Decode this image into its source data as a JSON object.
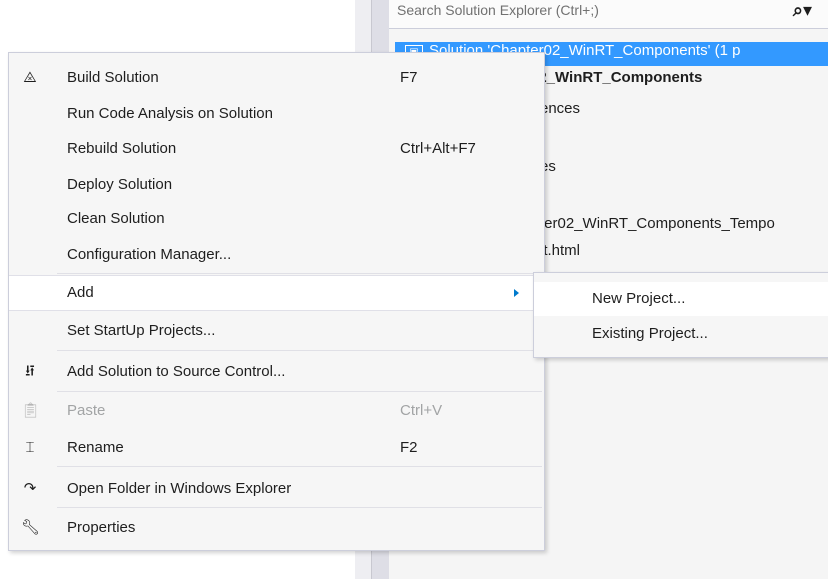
{
  "solution_explorer": {
    "search_placeholder": "Search Solution Explorer (Ctrl+;)",
    "search_icon": "magnifier-dropdown-icon",
    "selected_row": "Solution 'Chapter02_WinRT_Components' (1 p",
    "rows": [
      "02_WinRT_Components",
      "ences",
      "es",
      "ter02_WinRT_Components_Tempo",
      "lt.html"
    ]
  },
  "menu": {
    "items": [
      {
        "label": "Build Solution",
        "shortcut": "F7",
        "icon": "build-icon"
      },
      {
        "label": "Run Code Analysis on Solution",
        "shortcut": ""
      },
      {
        "label": "Rebuild Solution",
        "shortcut": "Ctrl+Alt+F7"
      },
      {
        "label": "Deploy Solution",
        "shortcut": ""
      },
      {
        "label": "Clean Solution",
        "shortcut": ""
      },
      {
        "label": "Configuration Manager...",
        "shortcut": ""
      },
      {
        "label": "Add",
        "shortcut": ""
      },
      {
        "label": "Set StartUp Projects...",
        "shortcut": ""
      },
      {
        "label": "Add Solution to Source Control...",
        "shortcut": "",
        "icon": "source-control-icon"
      },
      {
        "label": "Paste",
        "shortcut": "Ctrl+V",
        "icon": "paste-icon"
      },
      {
        "label": "Rename",
        "shortcut": "F2",
        "icon": "rename-icon"
      },
      {
        "label": "Open Folder in Windows Explorer",
        "shortcut": "",
        "icon": "open-folder-icon"
      },
      {
        "label": "Properties",
        "shortcut": "",
        "icon": "wrench-icon"
      }
    ]
  },
  "submenu": {
    "items": [
      {
        "label": "New Project..."
      },
      {
        "label": "Existing Project..."
      }
    ]
  }
}
